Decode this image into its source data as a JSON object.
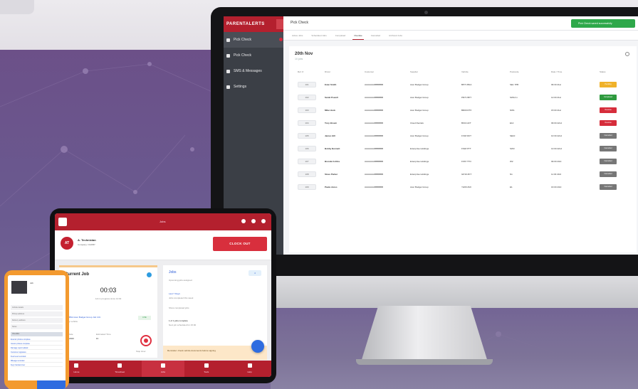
{
  "desktop": {
    "brand": "PARENTALERTS",
    "sidebar": [
      {
        "label": "Pick Check",
        "active": true
      },
      {
        "label": "Pick Check",
        "active": false
      },
      {
        "label": "SMS & Messages",
        "active": false
      },
      {
        "label": "Settings",
        "active": false
      }
    ],
    "header_title": "Pick Check",
    "toast": "Pick Check saved successfully",
    "tabs": [
      "Active Jobs",
      "Scheduled Jobs",
      "Completed",
      "Overdue",
      "Cancelled",
      "Archived Jobs"
    ],
    "card_title": "20th Nov",
    "card_subtitle": "10 jobs",
    "columns": [
      "Ref. #",
      "Driver",
      "Customer",
      "Supplier",
      "Vehicle",
      "Postcode",
      "Date / Time",
      "Status"
    ],
    "rows": [
      {
        "ref": "101",
        "driver": "Evan Smith",
        "customer": "AAAAAAABBBBBB",
        "supplier": "Acer Budget Group",
        "vehicle": "BP71 BNA",
        "postcode": "SE1 7PB",
        "datetime": "09:30 21st",
        "status": "Pending",
        "color": "#f0b22a"
      },
      {
        "ref": "102",
        "driver": "Sarah Powell",
        "customer": "AAAAAAABBBBBB",
        "supplier": "Acer Budget Group",
        "vehicle": "PR71 BPY",
        "postcode": "SW1A 1",
        "datetime": "12:00 21st",
        "status": "Completed",
        "color": "#2e9a3e"
      },
      {
        "ref": "103",
        "driver": "Mike Hook",
        "customer": "AAAAAAABBBBBB",
        "supplier": "Acer Budget Group",
        "vehicle": "BR09 RTX",
        "postcode": "NW1",
        "datetime": "15:00 21st",
        "status": "Overdue",
        "color": "#d62d3b"
      },
      {
        "ref": "104",
        "driver": "Tony Brown",
        "customer": "AAAAAAABBBBBB",
        "supplier": "Cloud Rentals",
        "vehicle": "BK19 AFT",
        "postcode": "E14",
        "datetime": "09:00 22nd",
        "status": "Overdue",
        "color": "#d62d3b"
      },
      {
        "ref": "105",
        "driver": "James Hill",
        "customer": "AAAAAAABBBBBB",
        "supplier": "Acer Budget Group",
        "vehicle": "FX18 DKT",
        "postcode": "SE10",
        "datetime": "10:30 22nd",
        "status": "Cancelled",
        "color": "#777"
      },
      {
        "ref": "106",
        "driver": "Bobby Bennett",
        "customer": "AAAAAAABBBBBB",
        "supplier": "Enterprise Holdings",
        "vehicle": "FS18 PTT",
        "postcode": "SW3",
        "datetime": "14:00 22nd",
        "status": "Cancelled",
        "color": "#777"
      },
      {
        "ref": "107",
        "driver": "Brenda Collins",
        "customer": "AAAAAAABBBBBB",
        "supplier": "Enterprise Holdings",
        "vehicle": "FK67 TTO",
        "postcode": "W2",
        "datetime": "09:00 23rd",
        "status": "Cancelled",
        "color": "#777"
      },
      {
        "ref": "108",
        "driver": "Steve Parker",
        "customer": "AAAAAAABBBBBB",
        "supplier": "Enterprise Holdings",
        "vehicle": "GP19 ZKT",
        "postcode": "N1",
        "datetime": "11:30 23rd",
        "status": "Cancelled",
        "color": "#777"
      },
      {
        "ref": "109",
        "driver": "Paula Jones",
        "customer": "AAAAAAABBBBBB",
        "supplier": "Acer Budget Group",
        "vehicle": "YH66 ZUF",
        "postcode": "E1",
        "datetime": "16:00 23rd",
        "status": "Cancelled",
        "color": "#777"
      }
    ]
  },
  "tablet": {
    "title": "Jobs",
    "avatar_initials": "AT",
    "user_name": "A. Technician",
    "company": "Company: OAKBY",
    "clockout_label": "CLOCK OUT",
    "current_job_title": "Current Job",
    "timer": "00:03",
    "timer_sub": "Job in progress since 14:02",
    "job_link": "BP71 BNA Acer Budget Group Job 101",
    "job_sub": "Pick up vehicle",
    "job_tag": "LIVE",
    "start_label": "Start Date",
    "start_value": "20/11/2023",
    "duration_label": "Estimated Time",
    "duration_value": "1h",
    "stop_label": "Stop timer",
    "r_title": "Jobs",
    "r_sub": "Upcoming jobs assigned",
    "r_chip": "4",
    "r_link": "Last 7 Days",
    "r_link_sub": "Jobs completed this week",
    "r_detail": "Show completed jobs",
    "r_count": "1 of 1 jobs complete",
    "r_count_sub": "Next job scheduled for 15:00",
    "banner": "Reminder: check vehicle documents before signing",
    "nav": [
      "Home",
      "Timesheet",
      "Jobs",
      "Tools",
      "Help"
    ]
  },
  "phone": {
    "title": "Job",
    "items": [
      "Vehicle details",
      "Pickup address",
      "Delivery address",
      "Notes"
    ],
    "section": "Checklist",
    "links": [
      "Exterior photos complete",
      "Interior photos complete",
      "Damage report added",
      "Customer signature",
      "Fuel level recorded",
      "Mileage recorded",
      "Keys handed over"
    ]
  }
}
